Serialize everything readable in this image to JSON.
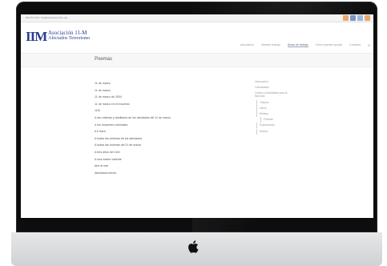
{
  "topbar": {
    "contact": "600 577 022 / info@asociacion11m.org",
    "socials": [
      {
        "name": "rss-icon",
        "color": "#e8a86a"
      },
      {
        "name": "facebook-icon",
        "color": "#7d93c4"
      },
      {
        "name": "twitter-icon",
        "color": "#9bb7dc"
      },
      {
        "name": "email-icon",
        "color": "#e8a86a"
      }
    ]
  },
  "header": {
    "logo_mark": "IIM",
    "logo_line1": "Asociación 11-M",
    "logo_line2": "Afectados Terrorismo",
    "nav": [
      "Asociación",
      "Nuestro trabajo",
      "Áreas de trabajo",
      "Cómo puedes ayudar",
      "Contacto"
    ],
    "active_nav_index": 2,
    "search_icon": "search-icon"
  },
  "page": {
    "title": "Poemas"
  },
  "poems": [
    "11 de marzo",
    "11 de marzo",
    "11 de marzo de 2004",
    "11 de marzo en el recuerdo",
    "11M",
    "A las víctimas y familiares de los atentados del 11 de marzo",
    "A los inocentes criminales",
    "A ti Sara",
    "A todas las víctimas de los atentados",
    "A todas las víctimas del 11 de marzo",
    "A tres años del 11M",
    "A una madre valiente",
    "Aire al mar",
    "Atentados trenes"
  ],
  "sidebar": {
    "items": [
      {
        "label": "Información",
        "level": 0
      },
      {
        "label": "Voluntariado",
        "level": 0
      },
      {
        "label": "Cultura y Actividades para la Memoria",
        "level": 0
      },
      {
        "label": "Tributos",
        "level": 1
      },
      {
        "label": "Libros",
        "level": 1
      },
      {
        "label": "Relatos",
        "level": 1
      },
      {
        "label": "Poemas",
        "level": 2
      },
      {
        "label": "Exposiciones",
        "level": 1
      },
      {
        "label": "Música",
        "level": 1
      }
    ]
  },
  "device": {
    "logo": "apple-logo-icon"
  }
}
